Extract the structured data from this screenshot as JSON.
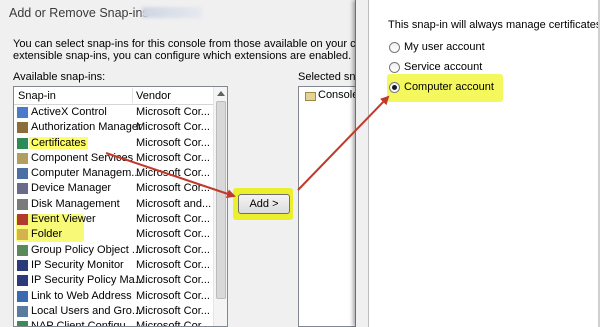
{
  "left_dialog": {
    "title": "Add or Remove Snap-ins",
    "description_line1": "You can select snap-ins for this console from those available on your computer",
    "description_line2": "extensible snap-ins, you can configure which extensions are enabled.",
    "available_label": "Available snap-ins:",
    "selected_label": "Selected snap",
    "columns": {
      "snapin": "Snap-in",
      "vendor": "Vendor"
    },
    "snapins": [
      {
        "name": "ActiveX Control",
        "vendor": "Microsoft Cor...",
        "icon": "activex-icon"
      },
      {
        "name": "Authorization Manager",
        "vendor": "Microsoft Cor...",
        "icon": "authorization-icon"
      },
      {
        "name": "Certificates",
        "vendor": "Microsoft Cor...",
        "icon": "certificates-icon",
        "selected": true
      },
      {
        "name": "Component Services",
        "vendor": "Microsoft Cor...",
        "icon": "component-services-icon"
      },
      {
        "name": "Computer Managem...",
        "vendor": "Microsoft Cor...",
        "icon": "computer-management-icon"
      },
      {
        "name": "Device Manager",
        "vendor": "Microsoft Cor...",
        "icon": "device-manager-icon"
      },
      {
        "name": "Disk Management",
        "vendor": "Microsoft and...",
        "icon": "disk-management-icon"
      },
      {
        "name": "Event Viewer",
        "vendor": "Microsoft Cor...",
        "icon": "event-viewer-icon"
      },
      {
        "name": "Folder",
        "vendor": "Microsoft Cor...",
        "icon": "folder-icon"
      },
      {
        "name": "Group Policy Object ...",
        "vendor": "Microsoft Cor...",
        "icon": "group-policy-icon"
      },
      {
        "name": "IP Security Monitor",
        "vendor": "Microsoft Cor...",
        "icon": "ip-security-monitor-icon"
      },
      {
        "name": "IP Security Policy Ma...",
        "vendor": "Microsoft Cor...",
        "icon": "ip-security-policy-icon"
      },
      {
        "name": "Link to Web Address",
        "vendor": "Microsoft Cor...",
        "icon": "link-icon"
      },
      {
        "name": "Local Users and Gro...",
        "vendor": "Microsoft Cor...",
        "icon": "local-users-icon"
      },
      {
        "name": "NAP Client Configu...",
        "vendor": "Microsoft Cor...",
        "icon": "nap-client-icon"
      }
    ],
    "add_button": "Add >",
    "selected_items": [
      "Console Root"
    ]
  },
  "right_dialog": {
    "label": "This snap-in will always manage certificates for:",
    "options": [
      {
        "label": "My user account",
        "checked": false
      },
      {
        "label": "Service account",
        "checked": false
      },
      {
        "label": "Computer account",
        "checked": true
      }
    ]
  },
  "colors": {
    "highlight": "#f4f74a",
    "annotation_arrow": "#c0392b"
  }
}
